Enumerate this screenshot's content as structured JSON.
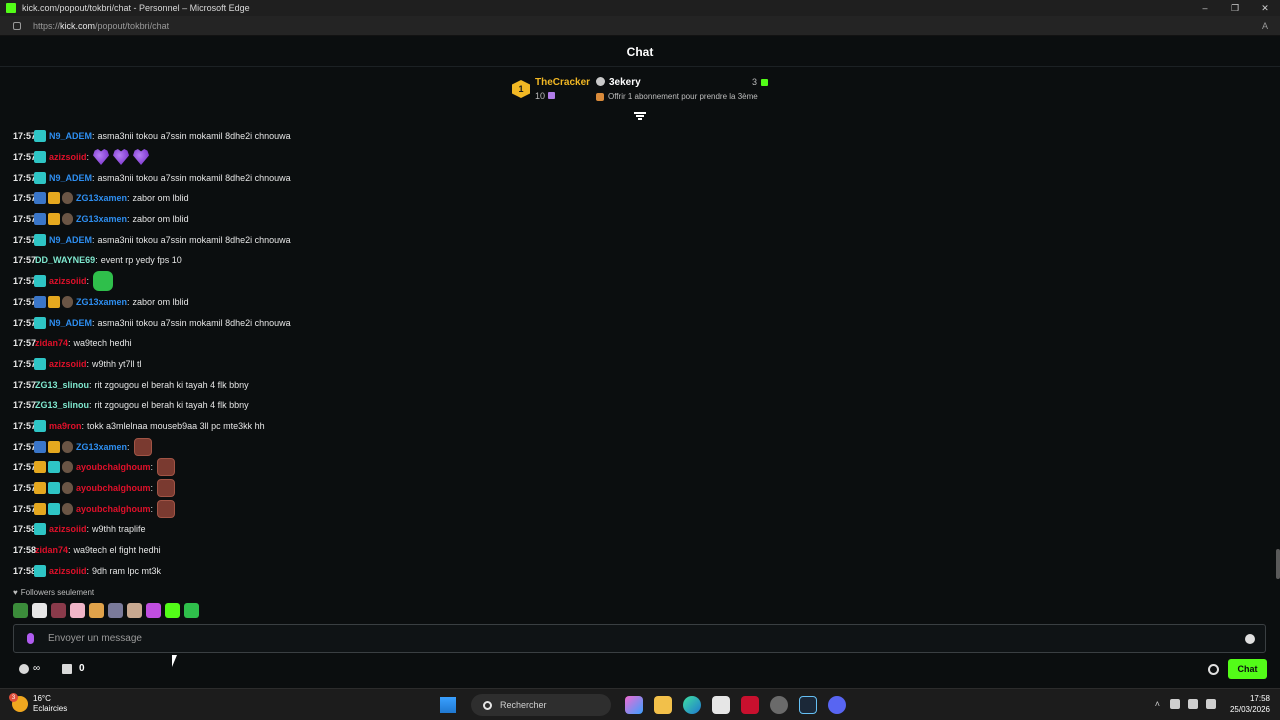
{
  "browser": {
    "title": "kick.com/popout/tokbri/chat - Personnel – Microsoft Edge",
    "url_prefix": "https://",
    "url_host": "kick.com",
    "url_path": "/popout/tokbri/chat",
    "reader_icon": "A"
  },
  "chat": {
    "title": "Chat",
    "leaderboard": {
      "first_rank": "1",
      "first_name": "TheCracker",
      "first_count": "10",
      "second_name": "3ekery",
      "second_count": "3",
      "offer_text": "Offrir 1 abonnement pour prendre la 3ème"
    },
    "messages": [
      {
        "time": "17:57",
        "badges": [
          "sub"
        ],
        "user": "N9_ADEM",
        "color": "#2e8ef0",
        "text": "asma3nii tokou a7ssin mokamil 8dhe2i chnouwa"
      },
      {
        "time": "17:57",
        "badges": [
          "sub"
        ],
        "user": "azizsoiid",
        "color": "#e0102a",
        "text": "",
        "emotes": [
          "heart",
          "heart",
          "heart"
        ]
      },
      {
        "time": "17:57",
        "badges": [
          "sub"
        ],
        "user": "N9_ADEM",
        "color": "#2e8ef0",
        "text": "asma3nii tokou a7ssin mokamil 8dhe2i chnouwa"
      },
      {
        "time": "17:57",
        "badges": [
          "sword",
          "crown",
          "og"
        ],
        "user": "ZG13xamen",
        "color": "#2e8ef0",
        "text": "zabor om lblid"
      },
      {
        "time": "17:57",
        "badges": [
          "sword",
          "crown",
          "og"
        ],
        "user": "ZG13xamen",
        "color": "#2e8ef0",
        "text": "zabor om lblid"
      },
      {
        "time": "17:57",
        "badges": [
          "sub"
        ],
        "user": "N9_ADEM",
        "color": "#2e8ef0",
        "text": "asma3nii tokou a7ssin mokamil 8dhe2i chnouwa"
      },
      {
        "time": "17:57",
        "badges": [],
        "user": "DD_WAYNE69",
        "color": "#7fe8cf",
        "text": "event rp yedy fps 10"
      },
      {
        "time": "17:57",
        "badges": [
          "sub"
        ],
        "user": "azizsoiid",
        "color": "#e0102a",
        "text": "",
        "emotes": [
          "frog"
        ]
      },
      {
        "time": "17:57",
        "badges": [
          "sword",
          "crown",
          "og"
        ],
        "user": "ZG13xamen",
        "color": "#2e8ef0",
        "text": "zabor om lblid"
      },
      {
        "time": "17:57",
        "badges": [
          "sub"
        ],
        "user": "N9_ADEM",
        "color": "#2e8ef0",
        "text": "asma3nii tokou a7ssin mokamil 8dhe2i chnouwa"
      },
      {
        "time": "17:57",
        "badges": [],
        "user": "zidan74",
        "color": "#e0102a",
        "text": "wa9tech hedhi"
      },
      {
        "time": "17:57",
        "badges": [
          "sub"
        ],
        "user": "azizsoiid",
        "color": "#e0102a",
        "text": "w9thh yt7ll tl"
      },
      {
        "time": "17:57",
        "badges": [],
        "user": "ZG13_slinou",
        "color": "#7fe8cf",
        "text": "rit zgougou el berah ki tayah 4 flk bbny"
      },
      {
        "time": "17:57",
        "badges": [],
        "user": "ZG13_slinou",
        "color": "#7fe8cf",
        "text": "rit zgougou el berah ki tayah 4 flk bbny"
      },
      {
        "time": "17:57",
        "badges": [
          "sub"
        ],
        "user": "ma9ron",
        "color": "#e0102a",
        "text": "tokk a3mlelnaa mouseb9aa 3ll pc mte3kk hh"
      },
      {
        "time": "17:57",
        "badges": [
          "sword",
          "crown",
          "og"
        ],
        "user": "ZG13xamen",
        "color": "#2e8ef0",
        "text": "",
        "emotes": [
          "pic"
        ]
      },
      {
        "time": "17:57",
        "badges": [
          "crown",
          "sub",
          "og"
        ],
        "user": "ayoubchalghoum",
        "color": "#e0102a",
        "text": "",
        "emotes": [
          "pic"
        ]
      },
      {
        "time": "17:57",
        "badges": [
          "crown",
          "sub",
          "og"
        ],
        "user": "ayoubchalghoum",
        "color": "#e0102a",
        "text": "",
        "emotes": [
          "pic"
        ]
      },
      {
        "time": "17:57",
        "badges": [
          "crown",
          "sub",
          "og"
        ],
        "user": "ayoubchalghoum",
        "color": "#e0102a",
        "text": "",
        "emotes": [
          "pic"
        ]
      },
      {
        "time": "17:58",
        "badges": [
          "sub"
        ],
        "user": "azizsoiid",
        "color": "#e0102a",
        "text": "w9thh traplife"
      },
      {
        "time": "17:58",
        "badges": [],
        "user": "zidan74",
        "color": "#e0102a",
        "text": "wa9tech el fight hedhi"
      },
      {
        "time": "17:58",
        "badges": [
          "sub"
        ],
        "user": "azizsoiid",
        "color": "#e0102a",
        "text": "9dh ram lpc mt3k"
      }
    ],
    "followers_only": "Followers seulement",
    "input_placeholder": "Envoyer un message",
    "points": "∞",
    "store_count": "0",
    "send_label": "Chat"
  },
  "taskbar": {
    "weather_badge": "3",
    "temperature": "16°C",
    "condition": "Eclaircies",
    "search_label": "Rechercher",
    "time": "17:58",
    "date": "25/03/2026"
  }
}
